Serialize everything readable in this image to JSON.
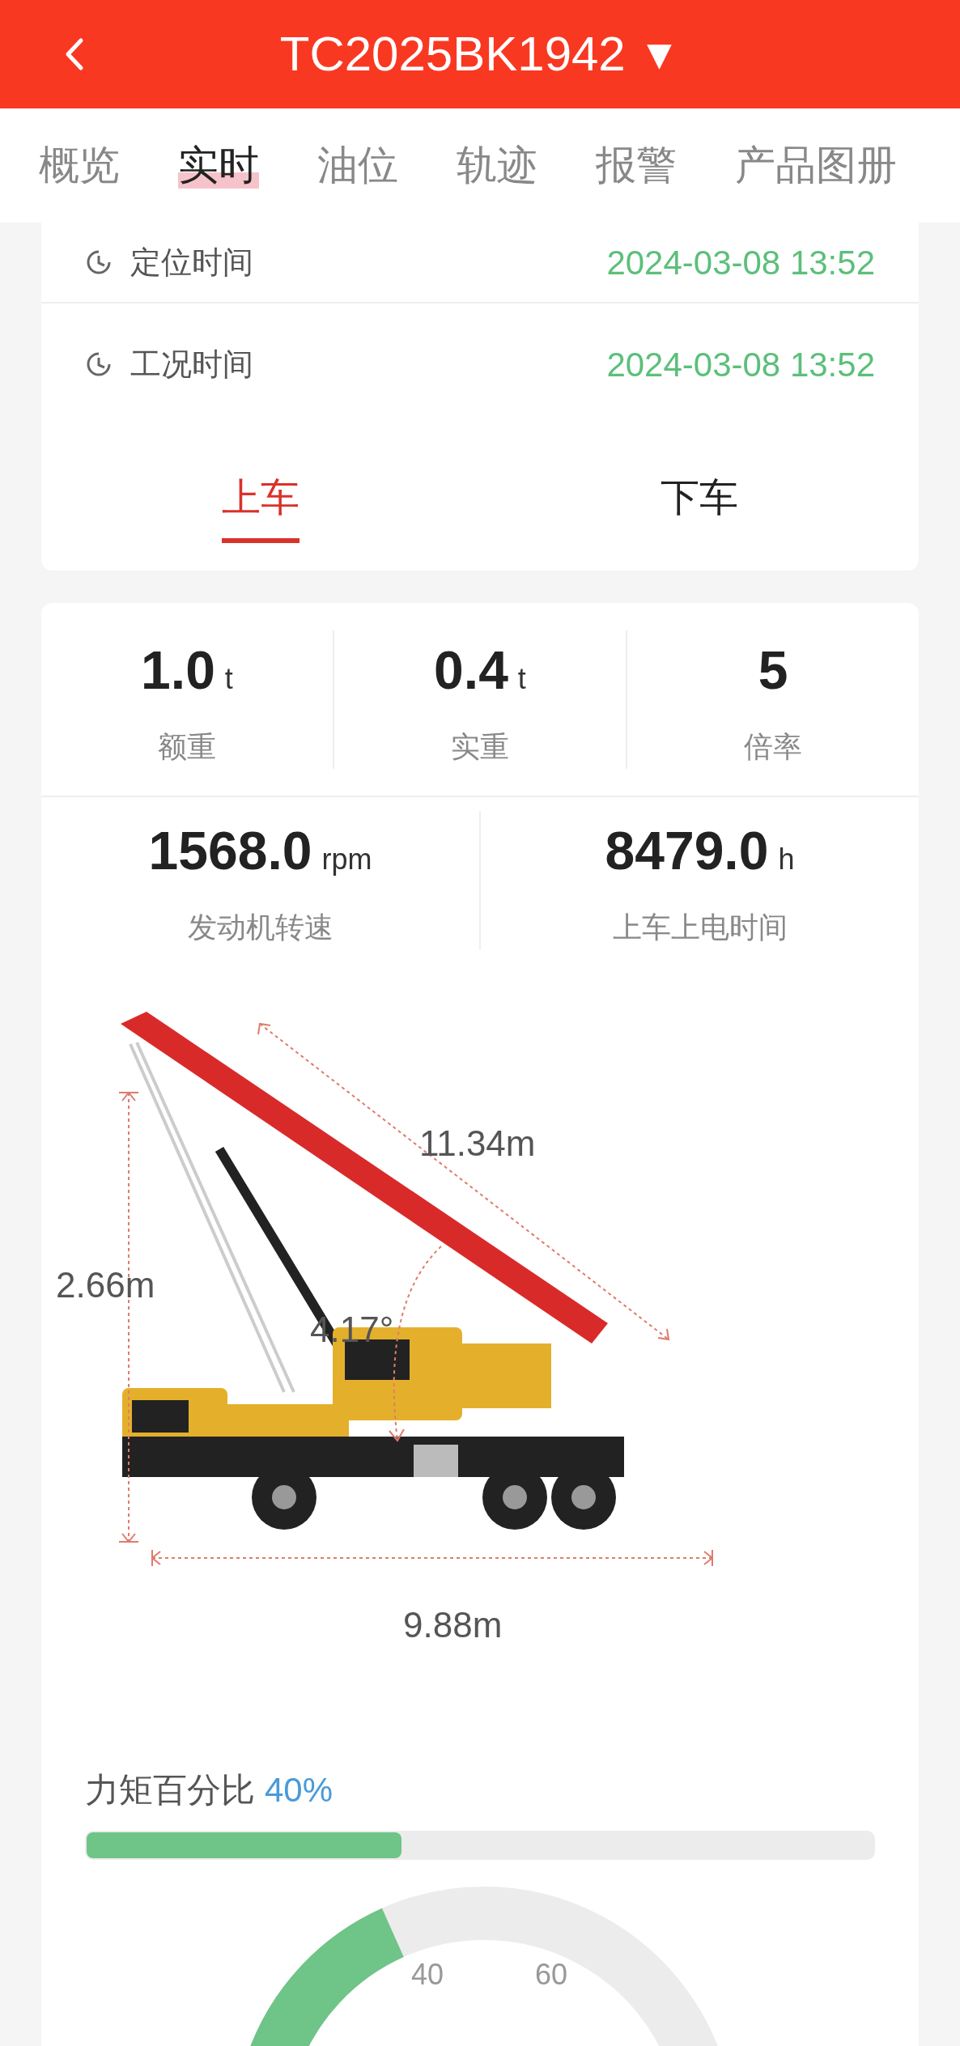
{
  "header": {
    "title": "TC2025BK1942",
    "title_caret": "▼"
  },
  "tabs": [
    {
      "label": "概览",
      "selected": false
    },
    {
      "label": "实时",
      "selected": true
    },
    {
      "label": "油位",
      "selected": false
    },
    {
      "label": "轨迹",
      "selected": false
    },
    {
      "label": "报警",
      "selected": false
    },
    {
      "label": "产品图册",
      "selected": false
    }
  ],
  "time_rows": [
    {
      "label": "定位时间",
      "value": "2024-03-08 13:52"
    },
    {
      "label": "工况时间",
      "value": "2024-03-08 13:52"
    }
  ],
  "section_tabs": [
    {
      "label": "上车",
      "selected": true
    },
    {
      "label": "下车",
      "selected": false
    }
  ],
  "stats_row_1": [
    {
      "value": "1.0",
      "unit": "t",
      "label": "额重"
    },
    {
      "value": "0.4",
      "unit": "t",
      "label": "实重"
    },
    {
      "value": "5",
      "label": "倍率"
    }
  ],
  "stats_row_2": [
    {
      "value": "1568.0",
      "unit": "rpm",
      "label": "发动机转速"
    },
    {
      "value": "8479.0",
      "unit": "h",
      "label": "上车上电时间"
    }
  ],
  "crane_dimensions": {
    "boom_length": "11.34m",
    "height": "2.66m",
    "angle": "4.17°",
    "length": "9.88m"
  },
  "moment": {
    "label": "力矩百分比",
    "percent": "40%",
    "level": 0.4
  },
  "gauge": {
    "tick_labels": [
      "40",
      "60"
    ]
  }
}
